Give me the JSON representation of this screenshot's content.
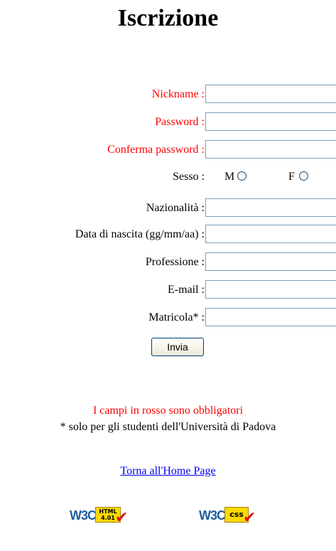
{
  "title": "Iscrizione",
  "form": {
    "fields": [
      {
        "label": "Nickname :",
        "required": true,
        "value": ""
      },
      {
        "label": "Password :",
        "required": true,
        "value": ""
      },
      {
        "label": "Conferma password :",
        "required": true,
        "value": ""
      },
      {
        "label": "Nazionalità :",
        "required": false,
        "value": ""
      },
      {
        "label": "Data di nascita (gg/mm/aa) :",
        "required": false,
        "value": ""
      },
      {
        "label": "Professione :",
        "required": false,
        "value": ""
      },
      {
        "label": "E-mail :",
        "required": false,
        "value": ""
      },
      {
        "label": "Matricola* :",
        "required": false,
        "value": ""
      }
    ],
    "sex": {
      "label": "Sesso :",
      "options": [
        {
          "label": "M",
          "checked": false
        },
        {
          "label": "F",
          "checked": false
        }
      ]
    },
    "submit_label": "Invia"
  },
  "notes": {
    "required_note": "I campi in rosso sono obbligatori",
    "students_note": "* solo per gli studenti dell'Università di Padova"
  },
  "home_link": "Torna all'Home Page",
  "badges": {
    "html": {
      "logo": "W3C",
      "tag_line1": "HTML",
      "tag_line2": "4.01"
    },
    "css": {
      "logo": "W3C",
      "tag": "css"
    }
  },
  "colors": {
    "required_text": "#ff0000",
    "link": "#0000ee",
    "input_border": "#7f9db9"
  }
}
